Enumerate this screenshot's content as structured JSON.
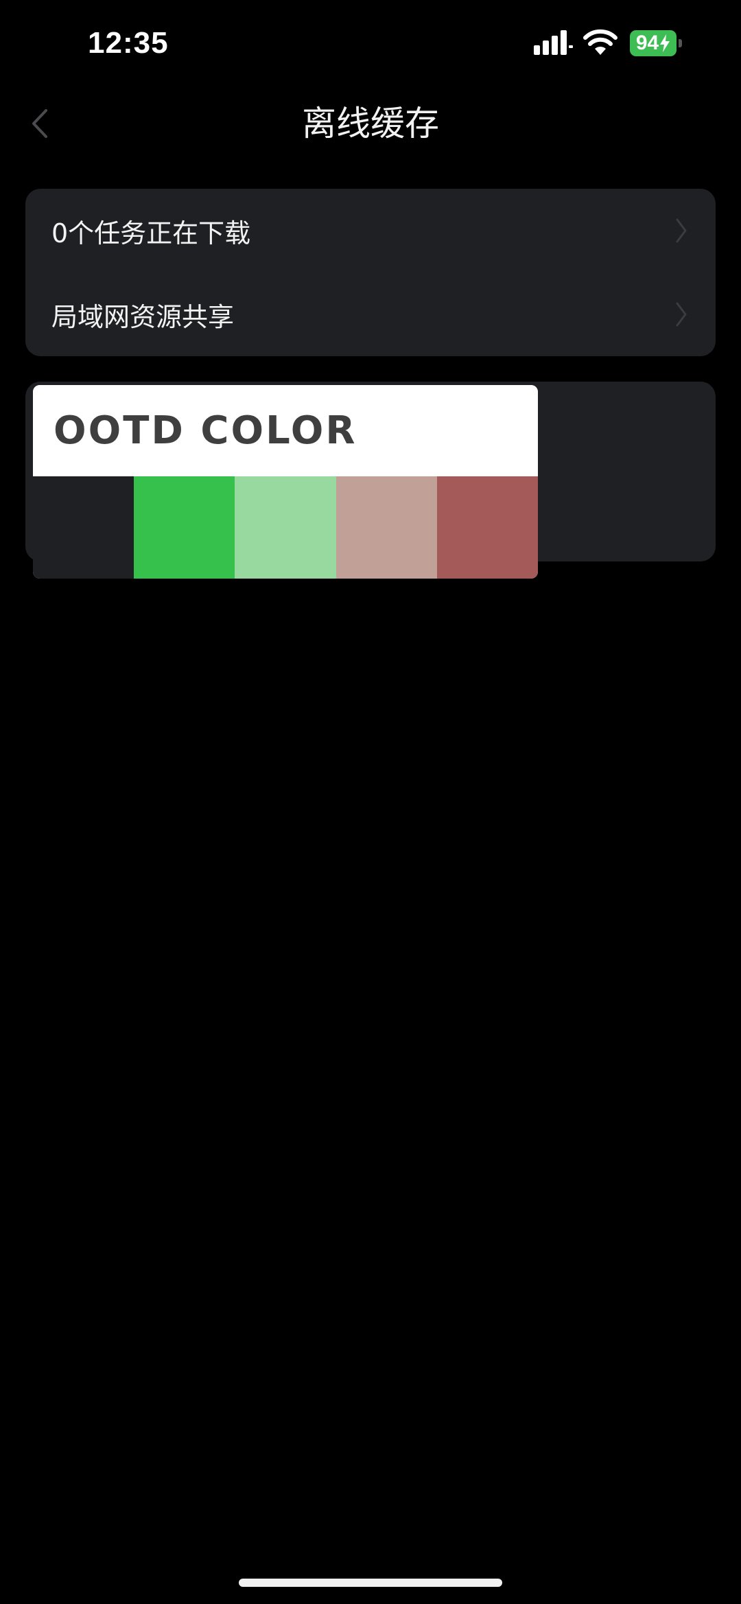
{
  "status_bar": {
    "time": "12:35",
    "battery_level": "94",
    "icons": [
      "signal-icon",
      "wifi-icon",
      "battery-icon",
      "charging-bolt-icon"
    ]
  },
  "nav": {
    "title": "离线缓存",
    "back_icon": "chevron-left-icon"
  },
  "group_1": {
    "items": [
      {
        "label": "0个任务正在下载"
      },
      {
        "label": "局域网资源共享"
      }
    ]
  },
  "palette": {
    "title": "OOTD COLOR",
    "colors": [
      "#1f2024",
      "#36c04c",
      "#98d9a0",
      "#c1a098",
      "#a35a59"
    ]
  },
  "colors": {
    "background": "#000000",
    "card": "#1f2024",
    "battery": "#3ebd55"
  }
}
